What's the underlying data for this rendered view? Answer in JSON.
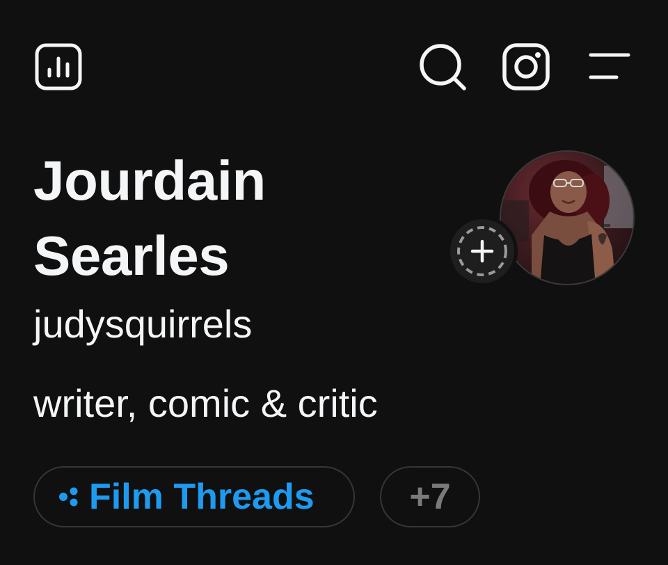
{
  "colors": {
    "background": "#101010",
    "text": "#f3f5f7",
    "accent": "#1d9bf0",
    "muted": "#7a7a7a",
    "chip_border": "#343638"
  },
  "toolbar": {
    "insights_icon": "bar-chart-icon",
    "search_icon": "search-icon",
    "instagram_icon": "instagram-icon",
    "menu_icon": "menu-icon"
  },
  "profile": {
    "name_line1": "Jourdain",
    "name_line2": "Searles",
    "username": "judysquirrels",
    "bio": "writer, comic & critic",
    "avatar_icon": "profile-photo",
    "add_story_icon": "plus-icon"
  },
  "communities": {
    "primary_icon": "community-dots-icon",
    "primary_label": "Film Threads",
    "more_label": "+7"
  }
}
